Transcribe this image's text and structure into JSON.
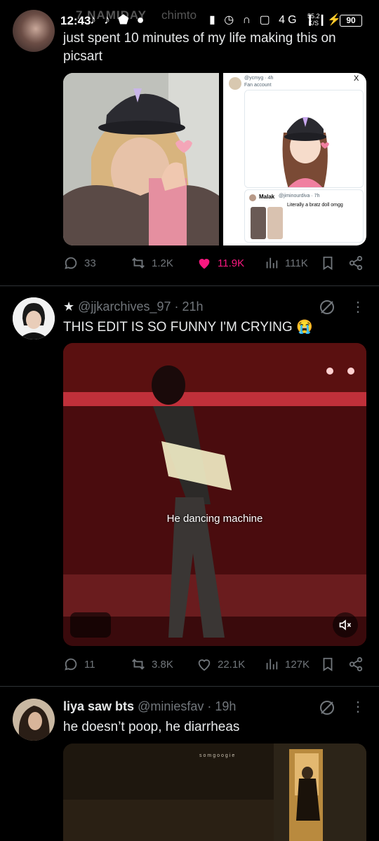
{
  "status_bar": {
    "time": "12:43",
    "left_icons": "♪ ♪ ⬟ ●",
    "ghost_text": "7 NAMIDAY",
    "ghost_text2": "chimto",
    "right_icons": "▮ ◷ ∩ ▢ 4G ❙❙",
    "net_speed": "55.2",
    "net_unit": "K/S",
    "battery": "90"
  },
  "tweets": [
    {
      "text_line1": "just spent 10 minutes of my life making this on",
      "text_line2": "picsart",
      "quoted": {
        "handle": "@ycmyg · 4h",
        "label": "Fan account",
        "reply_name": "Malak",
        "reply_handle": "@jiminourdiva · 7h",
        "reply_text": "Literally a bratz doll omgg",
        "close": "X"
      },
      "actions": {
        "replies": "33",
        "reposts": "1.2K",
        "likes": "11.9K",
        "views": "111K"
      }
    },
    {
      "star": "★",
      "handle": "@jjkarchives_97",
      "time": "· 21h",
      "text": "THIS EDIT IS SO FUNNY I'M CRYING 😭",
      "video_caption": "He dancing machine",
      "actions": {
        "replies": "11",
        "reposts": "3.8K",
        "likes": "22.1K",
        "views": "127K"
      }
    },
    {
      "name": "liya saw bts",
      "handle": "@miniesfav",
      "time": "· 19h",
      "text": "he doesn’t poop, he diarrheas",
      "watermark": "somgoogie"
    }
  ],
  "colors": {
    "like": "#f91880",
    "muted": "#71767b",
    "text": "#e7e9ea",
    "divider": "#2f3336"
  }
}
